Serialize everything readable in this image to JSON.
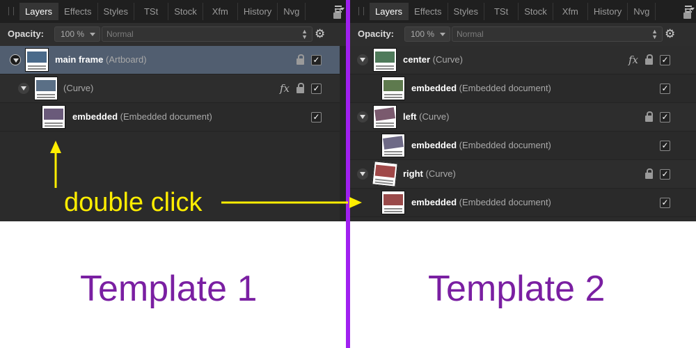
{
  "left_panel": {
    "tabs": [
      "Layers",
      "Effects",
      "Styles",
      "TSt",
      "Stock",
      "Xfm",
      "History",
      "Nvg"
    ],
    "active_tab": "Layers",
    "opacity_label": "Opacity:",
    "opacity_value": "100 %",
    "blend_mode": "Normal",
    "layers": [
      {
        "name": "main frame",
        "type": "(Artboard)",
        "selected": true,
        "locked": true,
        "fx": false,
        "visible": true
      },
      {
        "name": "",
        "type": "(Curve)",
        "selected": false,
        "locked": true,
        "fx": true,
        "visible": true
      },
      {
        "name": "embedded",
        "type": "(Embedded document)",
        "selected": false,
        "locked": false,
        "fx": false,
        "visible": true
      }
    ]
  },
  "right_panel": {
    "tabs": [
      "Layers",
      "Effects",
      "Styles",
      "TSt",
      "Stock",
      "Xfm",
      "History",
      "Nvg"
    ],
    "active_tab": "Layers",
    "opacity_label": "Opacity:",
    "opacity_value": "100 %",
    "blend_mode": "Normal",
    "layers": [
      {
        "name": "center",
        "type": "(Curve)",
        "locked": true,
        "fx": true,
        "visible": true
      },
      {
        "name": "embedded",
        "type": "(Embedded document)",
        "locked": false,
        "fx": false,
        "visible": true
      },
      {
        "name": "left",
        "type": "(Curve)",
        "locked": true,
        "fx": false,
        "visible": true
      },
      {
        "name": "embedded",
        "type": "(Embedded document)",
        "locked": false,
        "fx": false,
        "visible": true
      },
      {
        "name": "right",
        "type": "(Curve)",
        "locked": true,
        "fx": false,
        "visible": true
      },
      {
        "name": "embedded",
        "type": "(Embedded document)",
        "locked": false,
        "fx": false,
        "visible": true
      }
    ]
  },
  "annotation": {
    "text": "double click",
    "color": "#ffee00"
  },
  "captions": {
    "left": "Template 1",
    "right": "Template 2",
    "color": "#7a1fa2"
  },
  "divider_color": "#a020f0",
  "icons": {
    "settings": "gear-icon",
    "lock": "lock-icon",
    "effects": "fx-icon",
    "visibility": "checkbox-icon",
    "panel_menu": "hamburger-menu-icon"
  }
}
